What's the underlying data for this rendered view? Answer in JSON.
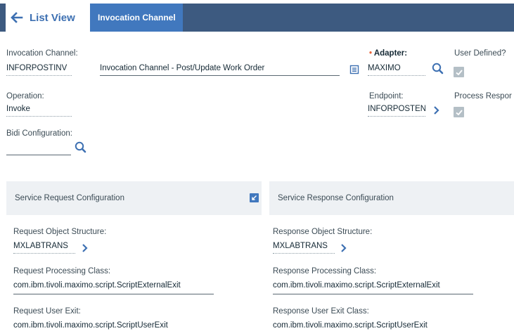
{
  "header": {
    "list_view_label": "List View",
    "active_tab": "Invocation Channel"
  },
  "form": {
    "invocation_channel_label": "Invocation Channel:",
    "invocation_channel_value": "INFORPOSTINV",
    "invocation_channel_desc": "Invocation Channel - Post/Update Work Order",
    "adapter_required_mark": "•",
    "adapter_label": "Adapter:",
    "adapter_value": "MAXIMO",
    "user_defined_label": "User Defined?",
    "operation_label": "Operation:",
    "operation_value": "Invoke",
    "endpoint_label": "Endpoint:",
    "endpoint_value": "INFORPOSTENI",
    "process_response_label": "Process Respor",
    "bidi_label": "Bidi Configuration:",
    "bidi_value": ""
  },
  "request_section": {
    "title": "Service Request Configuration",
    "object_structure_label": "Request Object Structure:",
    "object_structure_value": "MXLABTRANS",
    "processing_class_label": "Request Processing Class:",
    "processing_class_value": "com.ibm.tivoli.maximo.script.ScriptExternalExit",
    "user_exit_label": "Request User Exit:",
    "user_exit_value": "com.ibm.tivoli.maximo.script.ScriptUserExit"
  },
  "response_section": {
    "title": "Service Response Configuration",
    "object_structure_label": "Response Object Structure:",
    "object_structure_value": "MXLABTRANS",
    "processing_class_label": "Response Processing Class:",
    "processing_class_value": "com.ibm.tivoli.maximo.script.ScriptExternalExit",
    "user_exit_label": "Response User Exit Class:",
    "user_exit_value": "com.ibm.tivoli.maximo.script.ScriptUserExit"
  },
  "colors": {
    "topbar": "#3d5a80",
    "active_tab": "#4178be",
    "accent": "#3d70b2",
    "required": "#e8643a"
  }
}
